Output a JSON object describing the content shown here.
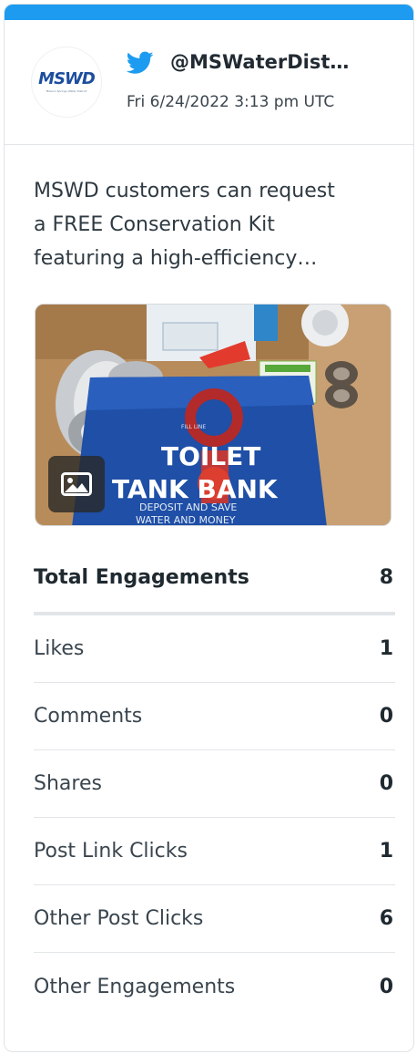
{
  "post": {
    "handle": "@MSWaterDist…",
    "timestamp": "Fri 6/24/2022 3:13 pm UTC",
    "avatar_text": "MSWD",
    "avatar_subtext": "Mission Springs Water District",
    "network_icon": "twitter-bird-icon",
    "text_lines": [
      "MSWD customers can request",
      "a FREE Conservation Kit",
      "featuring a high-efficiency…"
    ],
    "image": {
      "label_line1": "TOILET",
      "label_line2": "TANK BANK",
      "label_line3": "DEPOSIT AND SAVE",
      "label_line4": "WATER AND MONEY",
      "fill_line_text": "FILL LINE",
      "badge_icon": "image-icon"
    }
  },
  "colors": {
    "accent": "#1d9bf0",
    "logo": "#1d4e9e"
  },
  "stats": {
    "total": {
      "label": "Total Engagements",
      "value": "8"
    },
    "rows": [
      {
        "label": "Likes",
        "value": "1"
      },
      {
        "label": "Comments",
        "value": "0"
      },
      {
        "label": "Shares",
        "value": "0"
      },
      {
        "label": "Post Link Clicks",
        "value": "1"
      },
      {
        "label": "Other Post Clicks",
        "value": "6"
      },
      {
        "label": "Other Engagements",
        "value": "0"
      }
    ]
  }
}
